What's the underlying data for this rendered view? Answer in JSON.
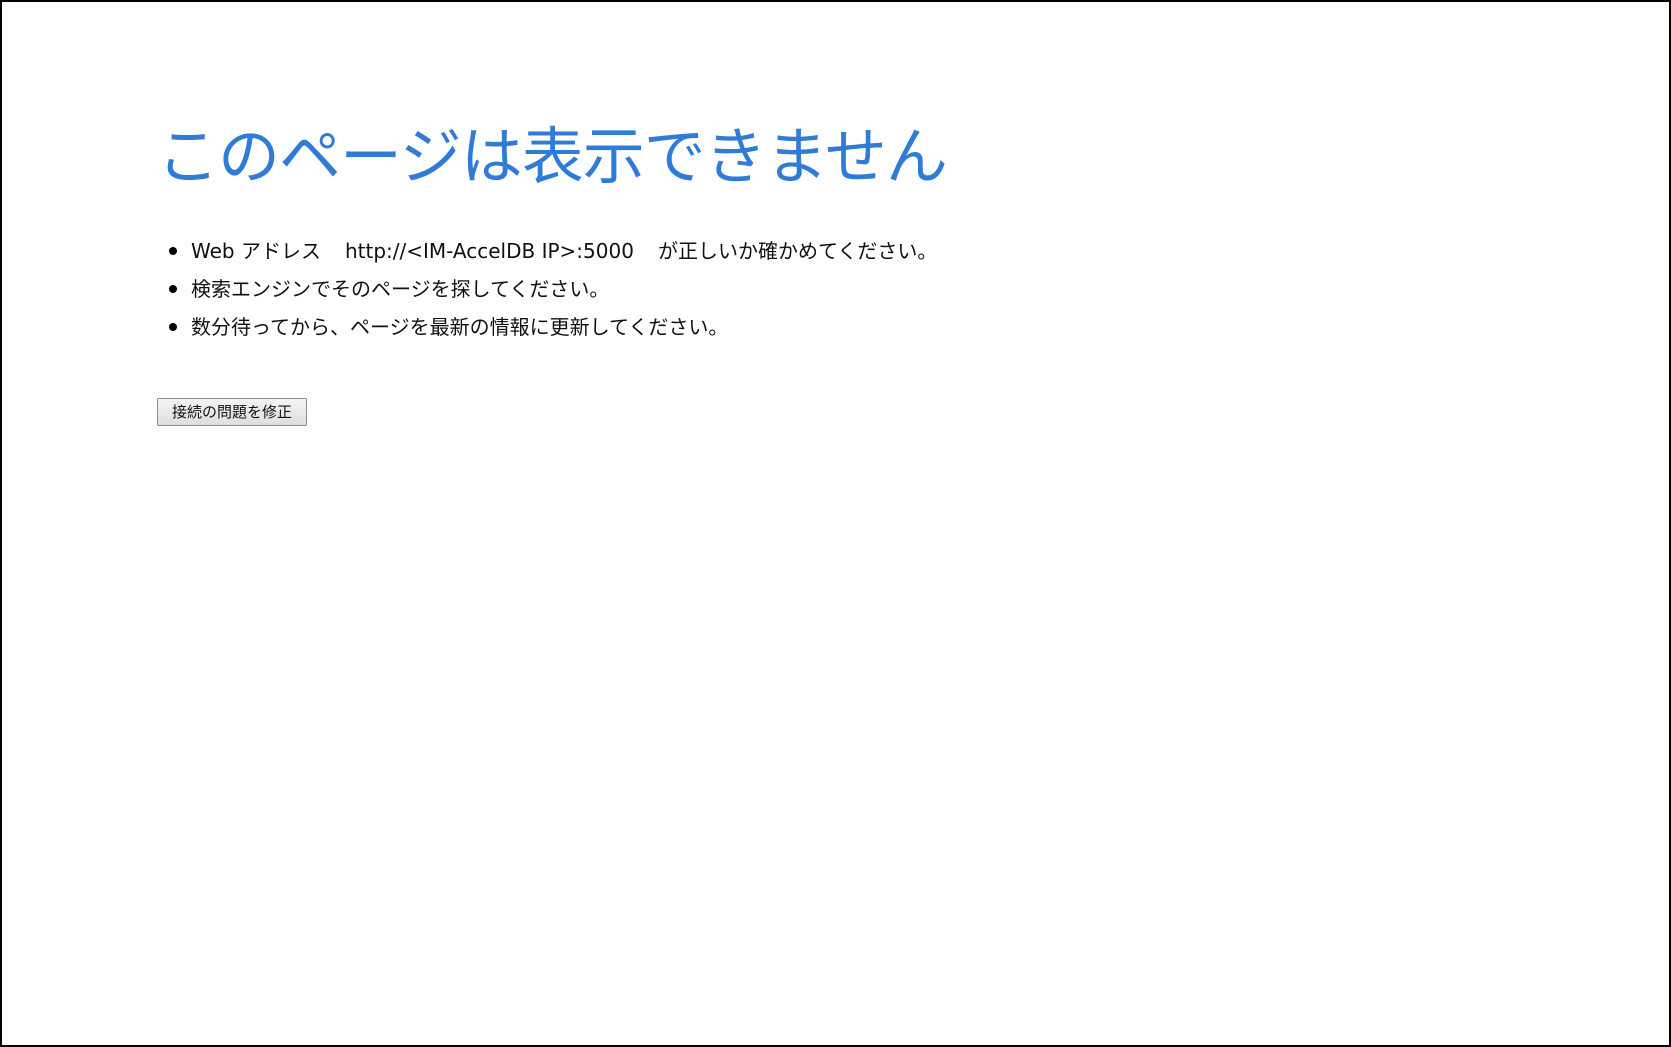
{
  "error_page": {
    "title": "このページは表示できません",
    "suggestions": [
      {
        "prefix": "Web アドレス",
        "address": "http://<IM-AccelDB IP>:5000",
        "suffix": "が正しいか確かめてください。"
      },
      {
        "text": "検索エンジンでそのページを探してください。"
      },
      {
        "text": "数分待ってから、ページを最新の情報に更新してください。"
      }
    ],
    "fix_button_label": "接続の問題を修正"
  },
  "colors": {
    "title": "#2f7bd6",
    "text": "#111111",
    "frame_border": "#000000"
  }
}
